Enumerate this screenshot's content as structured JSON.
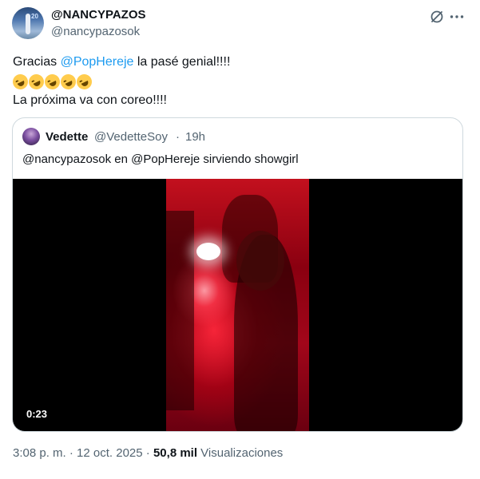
{
  "author": {
    "display_name": "@NANCYPAZOS",
    "handle": "@nancypazosok",
    "avatar_text": "20"
  },
  "tweet": {
    "text_before": "Gracias ",
    "mention": "@PopHereje",
    "text_after": " la pasé genial!!!!",
    "emoji": "rolling-on-floor-laughing",
    "emoji_count": 5,
    "line3": "La próxima va con coreo!!!!"
  },
  "quote": {
    "name": "Vedette",
    "handle": "@VedetteSoy",
    "separator": "·",
    "time": "19h",
    "text": "@nancypazosok en @PopHereje sirviendo showgirl",
    "video_duration": "0:23"
  },
  "meta": {
    "time": "3:08 p. m.",
    "sep1": " · ",
    "date": "12 oct. 2025",
    "sep2": " · ",
    "views_count": "50,8 mil",
    "views_label": " Visualizaciones"
  },
  "colors": {
    "text": "#0f1419",
    "secondary": "#536471",
    "link": "#1d9bf0",
    "border": "#cfd9de"
  },
  "icons": [
    "grok-icon",
    "more-icon"
  ]
}
